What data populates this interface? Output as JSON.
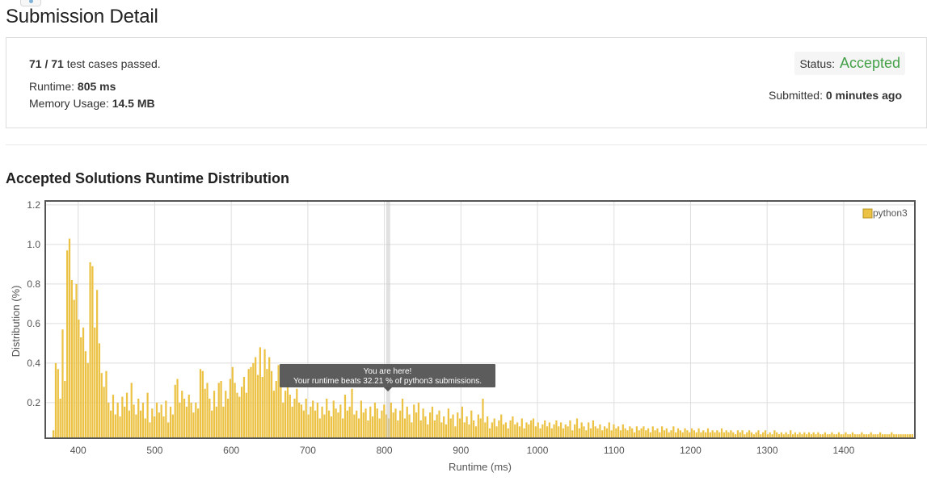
{
  "page": {
    "title": "Submission Detail"
  },
  "result": {
    "passed": "71 / 71",
    "passed_suffix": "test cases passed.",
    "runtime_label": "Runtime:",
    "runtime_value": "805 ms",
    "memory_label": "Memory Usage:",
    "memory_value": "14.5 MB",
    "status_label": "Status:",
    "status_value": "Accepted",
    "submitted_label": "Submitted:",
    "submitted_value": "0 minutes ago"
  },
  "colors": {
    "accepted": "#43a047",
    "bar": "#ecc244",
    "tooltip_bg": "#555555"
  },
  "chart_section": {
    "title": "Accepted Solutions Runtime Distribution"
  },
  "chart_data": {
    "type": "bar",
    "xlabel": "Runtime (ms)",
    "ylabel": "Distribution (%)",
    "xlim": [
      357,
      1493
    ],
    "ylim": [
      0.02,
      1.22
    ],
    "x_ticks": [
      400,
      500,
      600,
      700,
      800,
      900,
      1000,
      1100,
      1200,
      1300,
      1400
    ],
    "y_ticks": [
      0.2,
      0.4,
      0.6,
      0.8,
      1.0,
      1.2
    ],
    "y_tick_labels": [
      "0.2",
      "0.4",
      "0.6",
      "0.8",
      "1.0",
      "1.2"
    ],
    "grid": true,
    "legend": {
      "position": "top-right",
      "label": "python3"
    },
    "series": [
      {
        "name": "python3",
        "values": []
      }
    ],
    "bar_width_ms": 3,
    "highlight": {
      "x": 805,
      "tooltip_line1": "You are here!",
      "tooltip_line2": "Your runtime beats 32.21 % of python3 submissions."
    },
    "peaks": [
      [
        368,
        0.06
      ],
      [
        371,
        0.4
      ],
      [
        374,
        0.37
      ],
      [
        377,
        0.22
      ],
      [
        380,
        0.57
      ],
      [
        383,
        0.31
      ],
      [
        386,
        0.97
      ],
      [
        389,
        1.03
      ],
      [
        392,
        0.82
      ],
      [
        395,
        0.72
      ],
      [
        398,
        0.8
      ],
      [
        401,
        0.62
      ],
      [
        404,
        0.53
      ],
      [
        407,
        0.58
      ],
      [
        410,
        0.46
      ],
      [
        413,
        0.4
      ],
      [
        416,
        0.91
      ],
      [
        419,
        0.89
      ],
      [
        422,
        0.58
      ],
      [
        425,
        0.77
      ],
      [
        428,
        0.5
      ],
      [
        431,
        0.35
      ],
      [
        434,
        0.28
      ],
      [
        437,
        0.36
      ],
      [
        440,
        0.2
      ],
      [
        443,
        0.16
      ],
      [
        446,
        0.24
      ],
      [
        449,
        0.14
      ],
      [
        452,
        0.2
      ],
      [
        455,
        0.13
      ],
      [
        458,
        0.23
      ],
      [
        461,
        0.18
      ],
      [
        464,
        0.25
      ],
      [
        467,
        0.16
      ],
      [
        470,
        0.3
      ],
      [
        473,
        0.19
      ],
      [
        476,
        0.14
      ],
      [
        479,
        0.22
      ],
      [
        482,
        0.16
      ],
      [
        485,
        0.2
      ],
      [
        488,
        0.12
      ],
      [
        491,
        0.25
      ],
      [
        494,
        0.1
      ],
      [
        497,
        0.17
      ],
      [
        500,
        0.13
      ],
      [
        503,
        0.2
      ],
      [
        506,
        0.15
      ],
      [
        509,
        0.19
      ],
      [
        512,
        0.13
      ],
      [
        515,
        0.21
      ],
      [
        518,
        0.1
      ],
      [
        521,
        0.18
      ],
      [
        524,
        0.14
      ],
      [
        527,
        0.29
      ],
      [
        530,
        0.32
      ],
      [
        533,
        0.2
      ],
      [
        536,
        0.26
      ],
      [
        539,
        0.22
      ],
      [
        542,
        0.18
      ],
      [
        545,
        0.24
      ],
      [
        548,
        0.2
      ],
      [
        551,
        0.15
      ],
      [
        554,
        0.2
      ],
      [
        557,
        0.17
      ],
      [
        560,
        0.37
      ],
      [
        563,
        0.36
      ],
      [
        566,
        0.27
      ],
      [
        569,
        0.3
      ],
      [
        572,
        0.22
      ],
      [
        575,
        0.16
      ],
      [
        578,
        0.26
      ],
      [
        581,
        0.18
      ],
      [
        584,
        0.3
      ],
      [
        587,
        0.31
      ],
      [
        590,
        0.18
      ],
      [
        593,
        0.26
      ],
      [
        596,
        0.22
      ],
      [
        599,
        0.32
      ],
      [
        602,
        0.38
      ],
      [
        605,
        0.3
      ],
      [
        608,
        0.25
      ],
      [
        611,
        0.23
      ],
      [
        614,
        0.28
      ],
      [
        617,
        0.33
      ],
      [
        620,
        0.25
      ],
      [
        623,
        0.37
      ],
      [
        626,
        0.38
      ],
      [
        629,
        0.4
      ],
      [
        632,
        0.43
      ],
      [
        635,
        0.34
      ],
      [
        638,
        0.48
      ],
      [
        641,
        0.33
      ],
      [
        644,
        0.47
      ],
      [
        647,
        0.37
      ],
      [
        650,
        0.43
      ],
      [
        653,
        0.36
      ],
      [
        656,
        0.26
      ],
      [
        659,
        0.31
      ],
      [
        662,
        0.39
      ],
      [
        665,
        0.3
      ],
      [
        668,
        0.2
      ],
      [
        671,
        0.26
      ],
      [
        674,
        0.3
      ],
      [
        677,
        0.24
      ],
      [
        680,
        0.18
      ],
      [
        683,
        0.22
      ],
      [
        686,
        0.27
      ],
      [
        689,
        0.2
      ],
      [
        692,
        0.19
      ],
      [
        695,
        0.16
      ],
      [
        698,
        0.22
      ],
      [
        701,
        0.14
      ],
      [
        704,
        0.18
      ],
      [
        707,
        0.21
      ],
      [
        710,
        0.16
      ],
      [
        713,
        0.2
      ],
      [
        716,
        0.12
      ],
      [
        719,
        0.18
      ],
      [
        722,
        0.14
      ],
      [
        725,
        0.22
      ],
      [
        728,
        0.16
      ],
      [
        731,
        0.13
      ],
      [
        734,
        0.21
      ],
      [
        737,
        0.17
      ],
      [
        740,
        0.15
      ],
      [
        743,
        0.19
      ],
      [
        746,
        0.12
      ],
      [
        749,
        0.24
      ],
      [
        752,
        0.16
      ],
      [
        755,
        0.18
      ],
      [
        758,
        0.27
      ],
      [
        761,
        0.14
      ],
      [
        764,
        0.16
      ],
      [
        767,
        0.12
      ],
      [
        770,
        0.21
      ],
      [
        773,
        0.15
      ],
      [
        776,
        0.17
      ],
      [
        779,
        0.11
      ],
      [
        782,
        0.18
      ],
      [
        785,
        0.13
      ],
      [
        788,
        0.2
      ],
      [
        791,
        0.17
      ],
      [
        794,
        0.12
      ],
      [
        797,
        0.16
      ],
      [
        800,
        0.19
      ],
      [
        803,
        0.14
      ],
      [
        806,
        0.12
      ],
      [
        809,
        0.2
      ],
      [
        812,
        0.15
      ],
      [
        815,
        0.17
      ],
      [
        818,
        0.11
      ],
      [
        821,
        0.16
      ],
      [
        824,
        0.22
      ],
      [
        827,
        0.12
      ],
      [
        830,
        0.18
      ],
      [
        833,
        0.14
      ],
      [
        836,
        0.1
      ],
      [
        839,
        0.19
      ],
      [
        842,
        0.15
      ],
      [
        845,
        0.2
      ],
      [
        848,
        0.11
      ],
      [
        851,
        0.17
      ],
      [
        854,
        0.13
      ],
      [
        857,
        0.09
      ],
      [
        860,
        0.15
      ],
      [
        863,
        0.18
      ],
      [
        866,
        0.11
      ],
      [
        869,
        0.14
      ],
      [
        872,
        0.16
      ],
      [
        875,
        0.1
      ],
      [
        878,
        0.13
      ],
      [
        881,
        0.09
      ],
      [
        884,
        0.17
      ],
      [
        887,
        0.12
      ],
      [
        890,
        0.14
      ],
      [
        893,
        0.08
      ],
      [
        896,
        0.15
      ],
      [
        899,
        0.12
      ],
      [
        902,
        0.18
      ],
      [
        905,
        0.1
      ],
      [
        908,
        0.13
      ],
      [
        911,
        0.09
      ],
      [
        914,
        0.16
      ],
      [
        917,
        0.11
      ],
      [
        920,
        0.08
      ],
      [
        923,
        0.14
      ],
      [
        926,
        0.12
      ],
      [
        929,
        0.22
      ],
      [
        932,
        0.1
      ],
      [
        935,
        0.13
      ],
      [
        938,
        0.07
      ],
      [
        941,
        0.1
      ],
      [
        944,
        0.12
      ],
      [
        947,
        0.08
      ],
      [
        950,
        0.11
      ],
      [
        953,
        0.14
      ],
      [
        956,
        0.09
      ],
      [
        959,
        0.1
      ],
      [
        962,
        0.07
      ],
      [
        965,
        0.11
      ],
      [
        968,
        0.13
      ],
      [
        971,
        0.09
      ],
      [
        974,
        0.1
      ],
      [
        977,
        0.08
      ],
      [
        980,
        0.12
      ],
      [
        983,
        0.07
      ],
      [
        986,
        0.1
      ],
      [
        989,
        0.09
      ],
      [
        992,
        0.11
      ],
      [
        995,
        0.12
      ],
      [
        998,
        0.08
      ],
      [
        1001,
        0.1
      ],
      [
        1004,
        0.07
      ],
      [
        1007,
        0.09
      ],
      [
        1010,
        0.11
      ],
      [
        1013,
        0.08
      ],
      [
        1016,
        0.1
      ],
      [
        1019,
        0.07
      ],
      [
        1022,
        0.09
      ],
      [
        1025,
        0.11
      ],
      [
        1028,
        0.08
      ],
      [
        1031,
        0.1
      ],
      [
        1034,
        0.07
      ],
      [
        1037,
        0.09
      ],
      [
        1040,
        0.08
      ],
      [
        1043,
        0.11
      ],
      [
        1046,
        0.06
      ],
      [
        1049,
        0.09
      ],
      [
        1052,
        0.12
      ],
      [
        1055,
        0.07
      ],
      [
        1058,
        0.1
      ],
      [
        1061,
        0.08
      ],
      [
        1064,
        0.06
      ],
      [
        1067,
        0.1
      ],
      [
        1070,
        0.07
      ],
      [
        1073,
        0.11
      ],
      [
        1076,
        0.08
      ],
      [
        1079,
        0.07
      ],
      [
        1082,
        0.09
      ],
      [
        1085,
        0.06
      ],
      [
        1088,
        0.08
      ],
      [
        1091,
        0.07
      ],
      [
        1094,
        0.1
      ],
      [
        1097,
        0.06
      ],
      [
        1100,
        0.09
      ],
      [
        1103,
        0.07
      ],
      [
        1106,
        0.08
      ],
      [
        1109,
        0.06
      ],
      [
        1112,
        0.09
      ],
      [
        1115,
        0.07
      ],
      [
        1118,
        0.06
      ],
      [
        1121,
        0.08
      ],
      [
        1124,
        0.07
      ],
      [
        1127,
        0.05
      ],
      [
        1130,
        0.08
      ],
      [
        1133,
        0.06
      ],
      [
        1136,
        0.07
      ],
      [
        1139,
        0.08
      ],
      [
        1142,
        0.06
      ],
      [
        1145,
        0.07
      ],
      [
        1148,
        0.05
      ],
      [
        1151,
        0.08
      ],
      [
        1154,
        0.06
      ],
      [
        1157,
        0.07
      ],
      [
        1160,
        0.05
      ],
      [
        1163,
        0.08
      ],
      [
        1166,
        0.06
      ],
      [
        1169,
        0.07
      ],
      [
        1172,
        0.05
      ],
      [
        1175,
        0.06
      ],
      [
        1178,
        0.08
      ],
      [
        1181,
        0.05
      ],
      [
        1184,
        0.07
      ],
      [
        1187,
        0.06
      ],
      [
        1190,
        0.05
      ],
      [
        1193,
        0.07
      ],
      [
        1196,
        0.06
      ],
      [
        1199,
        0.05
      ],
      [
        1202,
        0.07
      ],
      [
        1205,
        0.06
      ],
      [
        1208,
        0.05
      ],
      [
        1211,
        0.07
      ],
      [
        1214,
        0.05
      ],
      [
        1217,
        0.06
      ],
      [
        1220,
        0.05
      ],
      [
        1223,
        0.07
      ],
      [
        1226,
        0.05
      ],
      [
        1229,
        0.06
      ],
      [
        1232,
        0.05
      ],
      [
        1235,
        0.06
      ],
      [
        1238,
        0.05
      ],
      [
        1241,
        0.07
      ],
      [
        1244,
        0.05
      ],
      [
        1247,
        0.06
      ],
      [
        1250,
        0.05
      ],
      [
        1253,
        0.06
      ],
      [
        1256,
        0.05
      ],
      [
        1259,
        0.04
      ],
      [
        1262,
        0.06
      ],
      [
        1265,
        0.05
      ],
      [
        1268,
        0.06
      ],
      [
        1271,
        0.04
      ],
      [
        1274,
        0.05
      ],
      [
        1277,
        0.06
      ],
      [
        1280,
        0.05
      ],
      [
        1283,
        0.04
      ],
      [
        1286,
        0.05
      ],
      [
        1289,
        0.06
      ],
      [
        1292,
        0.04
      ],
      [
        1295,
        0.05
      ],
      [
        1298,
        0.06
      ],
      [
        1301,
        0.04
      ],
      [
        1304,
        0.05
      ],
      [
        1307,
        0.04
      ],
      [
        1310,
        0.06
      ],
      [
        1313,
        0.05
      ],
      [
        1316,
        0.04
      ],
      [
        1319,
        0.05
      ],
      [
        1322,
        0.04
      ],
      [
        1325,
        0.05
      ],
      [
        1328,
        0.04
      ],
      [
        1331,
        0.06
      ],
      [
        1334,
        0.04
      ],
      [
        1337,
        0.05
      ],
      [
        1340,
        0.04
      ],
      [
        1343,
        0.05
      ],
      [
        1346,
        0.04
      ],
      [
        1349,
        0.05
      ],
      [
        1352,
        0.04
      ],
      [
        1355,
        0.05
      ],
      [
        1358,
        0.04
      ],
      [
        1361,
        0.05
      ],
      [
        1364,
        0.04
      ],
      [
        1367,
        0.05
      ],
      [
        1370,
        0.04
      ],
      [
        1373,
        0.04
      ],
      [
        1376,
        0.05
      ],
      [
        1379,
        0.04
      ],
      [
        1382,
        0.04
      ],
      [
        1385,
        0.05
      ],
      [
        1388,
        0.04
      ],
      [
        1391,
        0.04
      ],
      [
        1394,
        0.05
      ],
      [
        1397,
        0.04
      ],
      [
        1400,
        0.04
      ],
      [
        1403,
        0.05
      ],
      [
        1406,
        0.04
      ],
      [
        1409,
        0.04
      ],
      [
        1412,
        0.05
      ],
      [
        1415,
        0.04
      ],
      [
        1418,
        0.04
      ],
      [
        1421,
        0.04
      ],
      [
        1424,
        0.05
      ],
      [
        1427,
        0.04
      ],
      [
        1430,
        0.04
      ],
      [
        1433,
        0.04
      ],
      [
        1436,
        0.05
      ],
      [
        1439,
        0.04
      ],
      [
        1442,
        0.04
      ],
      [
        1445,
        0.04
      ],
      [
        1448,
        0.05
      ],
      [
        1451,
        0.04
      ],
      [
        1454,
        0.04
      ],
      [
        1457,
        0.04
      ],
      [
        1460,
        0.04
      ],
      [
        1463,
        0.05
      ],
      [
        1466,
        0.04
      ],
      [
        1469,
        0.04
      ],
      [
        1472,
        0.04
      ],
      [
        1475,
        0.04
      ],
      [
        1478,
        0.04
      ],
      [
        1481,
        0.04
      ],
      [
        1484,
        0.04
      ],
      [
        1487,
        0.04
      ],
      [
        1490,
        0.04
      ]
    ]
  }
}
